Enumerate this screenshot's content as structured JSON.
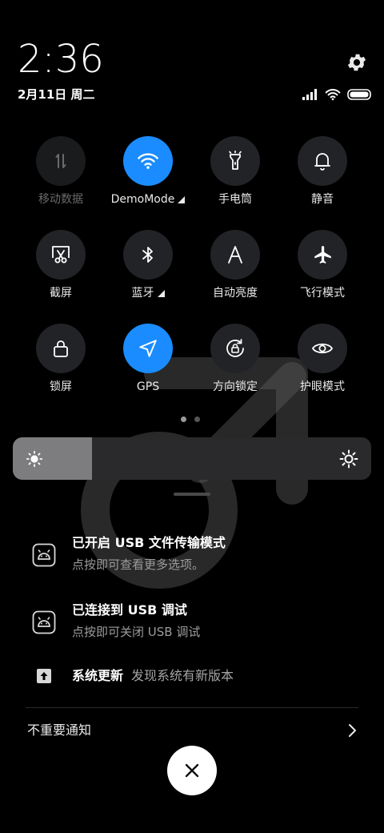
{
  "status": {
    "time": "2:36",
    "date": "2月11日 周二",
    "signal_icon": "signal-icon",
    "wifi_icon": "wifi-icon",
    "battery_icon": "battery-icon"
  },
  "settings_icon": "gear-icon",
  "toggles": [
    {
      "label": "移动数据",
      "icon": "mobile-data-icon",
      "state": "disabled",
      "has_arrow": false
    },
    {
      "label": "DemoMode",
      "icon": "wifi-icon",
      "state": "on",
      "has_arrow": true
    },
    {
      "label": "手电筒",
      "icon": "flashlight-icon",
      "state": "off",
      "has_arrow": false
    },
    {
      "label": "静音",
      "icon": "bell-icon",
      "state": "off",
      "has_arrow": false
    },
    {
      "label": "截屏",
      "icon": "screenshot-icon",
      "state": "off",
      "has_arrow": false
    },
    {
      "label": "蓝牙",
      "icon": "bluetooth-icon",
      "state": "off",
      "has_arrow": true
    },
    {
      "label": "自动亮度",
      "icon": "auto-brightness-icon",
      "state": "off",
      "has_arrow": false
    },
    {
      "label": "飞行模式",
      "icon": "airplane-icon",
      "state": "off",
      "has_arrow": false
    },
    {
      "label": "锁屏",
      "icon": "lock-icon",
      "state": "off",
      "has_arrow": false
    },
    {
      "label": "GPS",
      "icon": "location-icon",
      "state": "on",
      "has_arrow": false
    },
    {
      "label": "方向锁定",
      "icon": "rotation-lock-icon",
      "state": "off",
      "has_arrow": false
    },
    {
      "label": "护眼模式",
      "icon": "eye-icon",
      "state": "off",
      "has_arrow": false
    }
  ],
  "pager": {
    "pages": 2,
    "current": 1
  },
  "brightness": {
    "level": 0.22
  },
  "colors": {
    "accent": "#1a8cff",
    "tile": "#222326",
    "background": "#000000"
  },
  "notifications": [
    {
      "title": "已开启 USB 文件传输模式",
      "subtitle": "点按即可查看更多选项。",
      "icon": "android-icon"
    },
    {
      "title": "已连接到 USB 调试",
      "subtitle": "点按即可关闭 USB 调试",
      "icon": "android-icon"
    },
    {
      "title": "系统更新",
      "subtitle": "发现系统有新版本",
      "icon": "system-update-icon"
    }
  ],
  "unimportant": {
    "label": "不重要通知"
  },
  "clear_button_icon": "close-icon"
}
